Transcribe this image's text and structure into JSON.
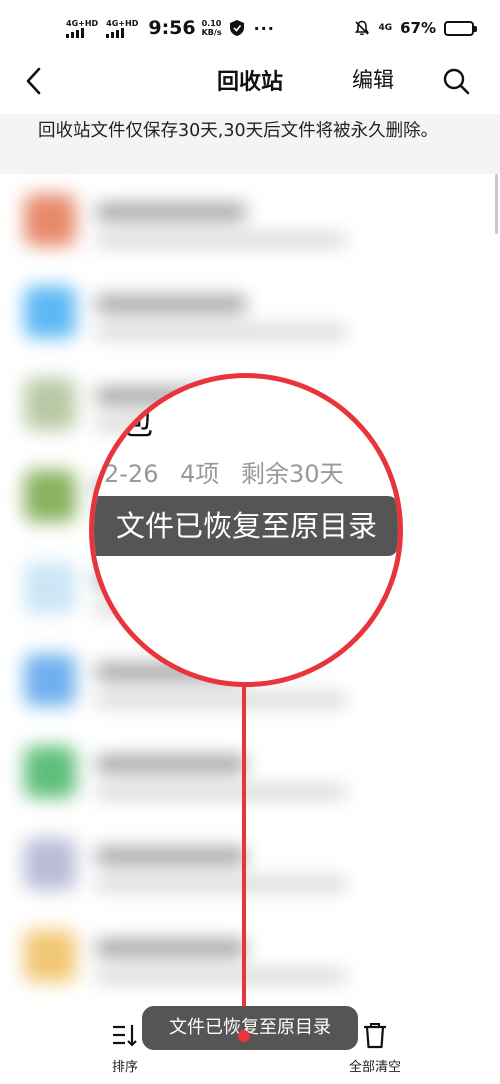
{
  "status_bar": {
    "sim1_label": "4G+HD",
    "sim2_label": "4G+HD",
    "time": "9:56",
    "speed_value": "0.10",
    "speed_unit": "KB/s",
    "more": "···",
    "network": "4G",
    "battery": "67%",
    "battery_level": 0.67
  },
  "header": {
    "title": "回收站",
    "edit_label": "编辑"
  },
  "notice": "回收站文件仅保存30天,30天后文件将被永久删除。",
  "magnifier": {
    "title_fragment": "包",
    "date_fragment": "2-26",
    "count": "4项",
    "remaining": "剩余30天",
    "toast": "文件已恢复至原目录"
  },
  "bottom_bar": {
    "sort_label": "排序",
    "clear_label": "全部清空"
  },
  "toast": "文件已恢复至原目录",
  "colors": {
    "highlight": "#e8353b",
    "toast_bg": "#555555",
    "notice_bg": "#f4f4f4"
  },
  "blurred_icon_colors": [
    "#e8896a",
    "#5db8f5",
    "#b9c9a5",
    "#8ab25f",
    "#cbe6f6",
    "#6fb0ee",
    "#5fbf7a",
    "#b9bcd7",
    "#f2c774"
  ]
}
